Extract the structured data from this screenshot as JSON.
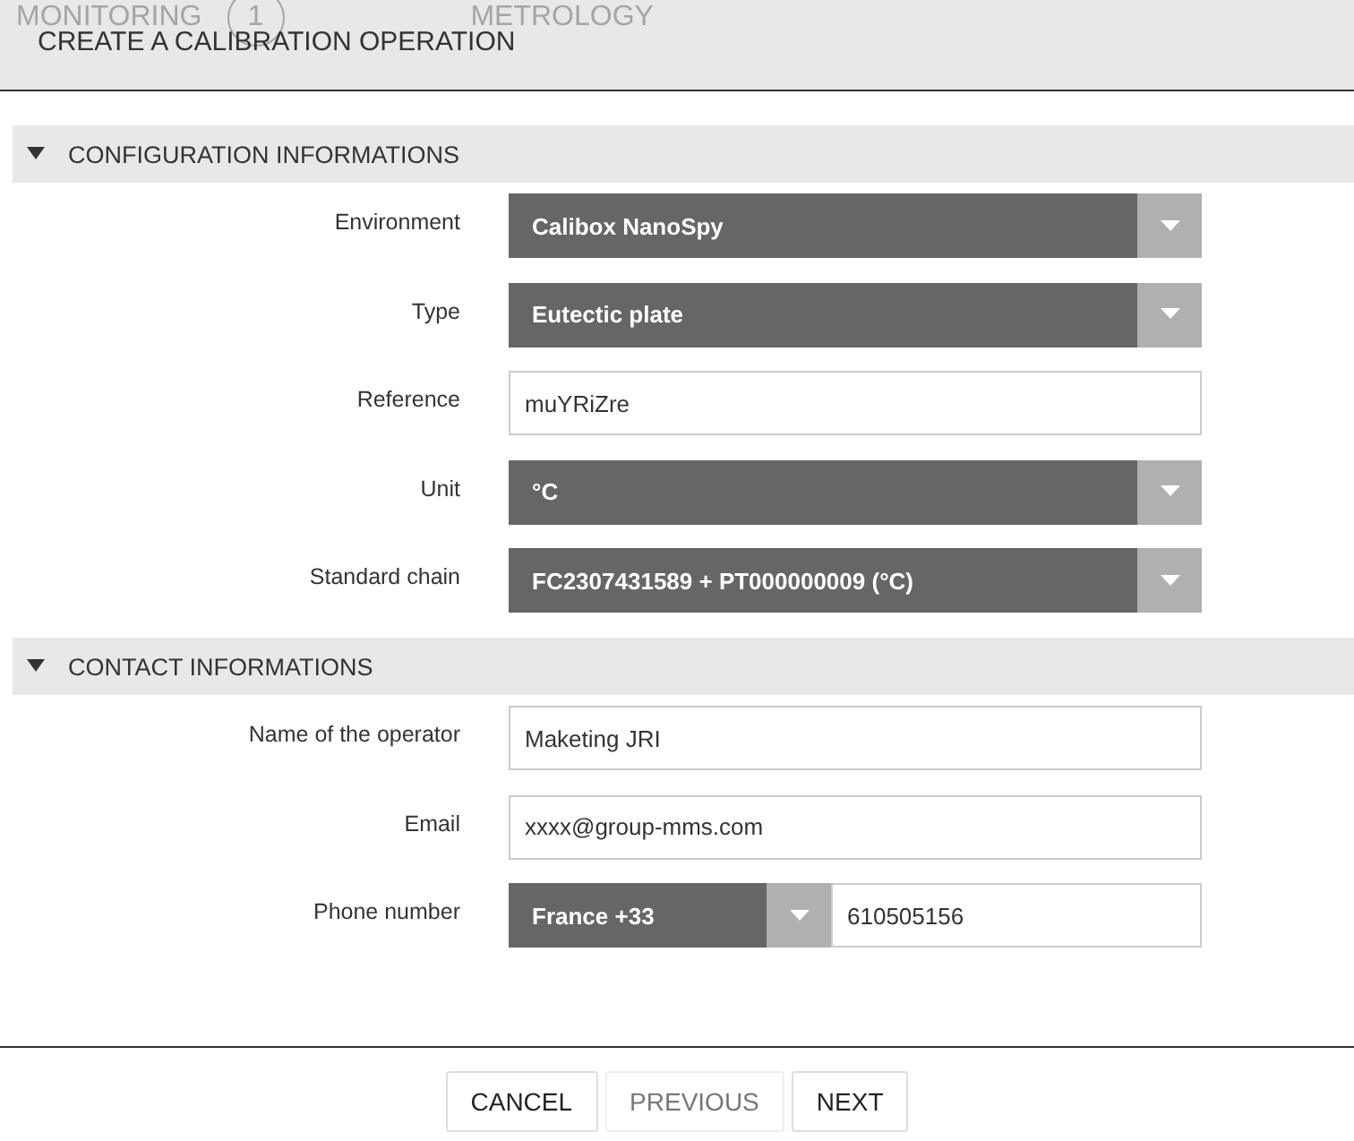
{
  "background_nav": {
    "items": [
      {
        "label": "MONITORING",
        "badge": "1"
      },
      {
        "label": "METROLOGY"
      }
    ]
  },
  "dialog": {
    "title": "CREATE A CALIBRATION OPERATION"
  },
  "sections": [
    {
      "title": "CONFIGURATION INFORMATIONS",
      "expanded": true,
      "fields": [
        {
          "kind": "select",
          "label": "Environment",
          "value": "Calibox NanoSpy"
        },
        {
          "kind": "select",
          "label": "Type",
          "value": "Eutectic plate"
        },
        {
          "kind": "text",
          "label": "Reference",
          "value": "muYRiZre"
        },
        {
          "kind": "select",
          "label": "Unit",
          "value": "°C"
        },
        {
          "kind": "select",
          "label": "Standard chain",
          "value": "FC2307431589 + PT000000009 (°C)"
        }
      ]
    },
    {
      "title": "CONTACT INFORMATIONS",
      "expanded": true,
      "fields": [
        {
          "kind": "text",
          "label": "Name of the operator",
          "value": "Maketing JRI"
        },
        {
          "kind": "text",
          "label": "Email",
          "value": "xxxx@group-mms.com"
        },
        {
          "kind": "phone",
          "label": "Phone number",
          "country": "France +33",
          "value": "610505156"
        }
      ]
    }
  ],
  "buttons": [
    {
      "label": "CANCEL",
      "disabled": false
    },
    {
      "label": "PREVIOUS",
      "disabled": true
    },
    {
      "label": "NEXT",
      "disabled": false
    }
  ]
}
